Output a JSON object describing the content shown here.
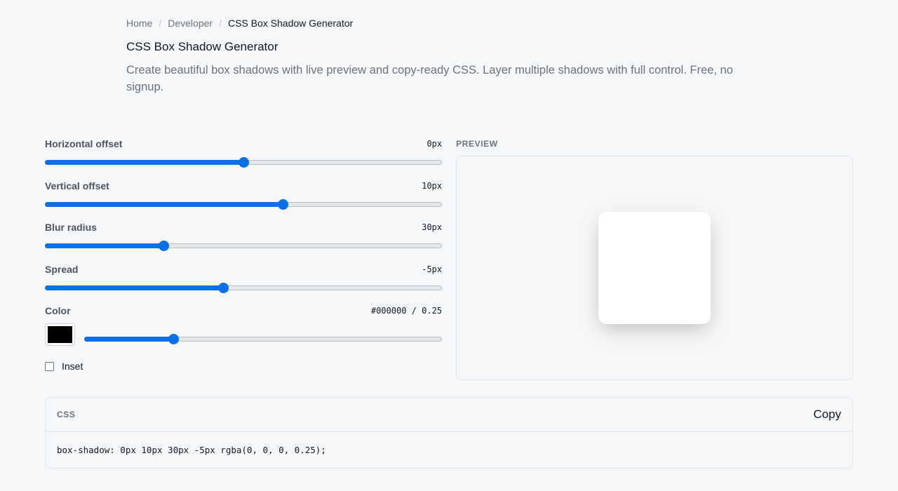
{
  "breadcrumb": {
    "items": [
      "Home",
      "Developer"
    ],
    "separator": "/",
    "current": "CSS Box Shadow Generator"
  },
  "page": {
    "title": "CSS Box Shadow Generator",
    "description": "Create beautiful box shadows with live preview and copy-ready CSS. Layer multiple shadows with full control. Free, no signup."
  },
  "controls": {
    "horizontal": {
      "label": "Horizontal offset",
      "value": "0px",
      "fraction": 0.5
    },
    "vertical": {
      "label": "Vertical offset",
      "value": "10px",
      "fraction": 0.6
    },
    "blur": {
      "label": "Blur radius",
      "value": "30px",
      "fraction": 0.3
    },
    "spread": {
      "label": "Spread",
      "value": "-5px",
      "fraction": 0.45
    },
    "color": {
      "label": "Color",
      "value": "#000000 / 0.25",
      "hex": "#000000",
      "opacity_fraction": 0.25
    },
    "inset": {
      "label": "Inset",
      "checked": false
    }
  },
  "preview": {
    "label": "PREVIEW"
  },
  "css_output": {
    "label": "CSS",
    "copy_label": "Copy",
    "code": "box-shadow: 0px 10px 30px -5px rgba(0, 0, 0, 0.25);"
  },
  "colors": {
    "accent": "#0b6fe6",
    "background": "#f6f7f9"
  }
}
